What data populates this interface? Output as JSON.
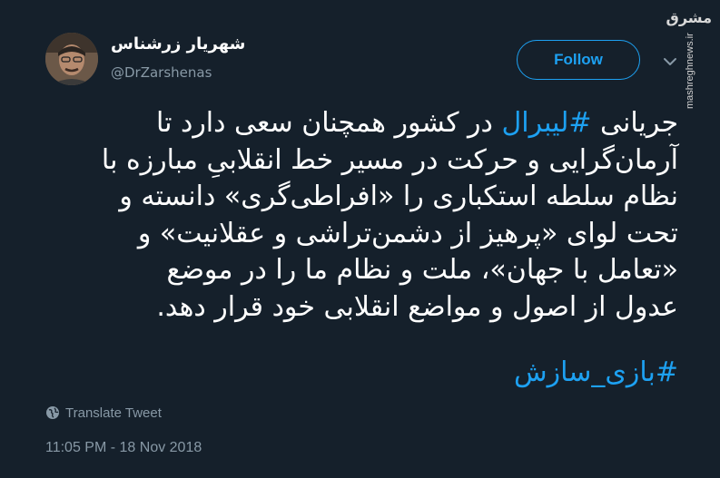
{
  "author": {
    "display_name": "شهریار زرشناس",
    "handle": "@DrZarshenas",
    "avatar_icon": "profile-photo"
  },
  "follow_button": {
    "label": "Follow"
  },
  "watermark": {
    "logo_text": "مشرق",
    "url_text": "mashreghnews.ir"
  },
  "tweet": {
    "lines": [
      {
        "pre": "جریانی ",
        "tag": "#لیبرال",
        "post": " در کشور همچنان سعی دارد تا"
      },
      {
        "pre": "آرمان‌گرایی و حرکت در مسیر خط انقلابیِ مبارزه با",
        "tag": "",
        "post": ""
      },
      {
        "pre": "نظام سلطه استکباری را «افراطی‌گری» دانسته و",
        "tag": "",
        "post": ""
      },
      {
        "pre": "تحت لوای «پرهیز از دشمن‌تراشی و عقلانیت» و",
        "tag": "",
        "post": ""
      },
      {
        "pre": "«تعامل با جهان»، ملت و نظام ما را در موضع",
        "tag": "",
        "post": ""
      },
      {
        "pre": "عدول از اصول و مواضع انقلابی خود قرار دهد.",
        "tag": "",
        "post": ""
      }
    ],
    "hashtag": "#بازی_سازش"
  },
  "translate": {
    "label": "Translate Tweet",
    "icon": "globe-icon"
  },
  "timestamp": "11:05 PM - 18 Nov 2018",
  "colors": {
    "background": "#15202b",
    "accent": "#1da1f2",
    "muted": "#8899a6",
    "text": "#ffffff"
  }
}
